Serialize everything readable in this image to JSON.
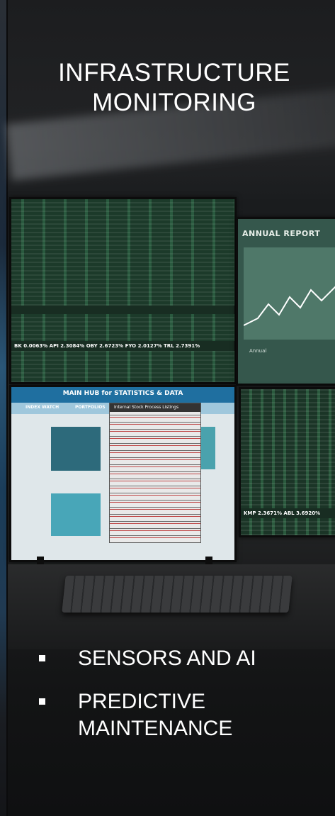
{
  "title": "INFRASTRUCTURE MONITORING",
  "title_lines": [
    "INFRASTRUCTURE",
    "MONITORING"
  ],
  "bullets": [
    {
      "lines": [
        "SENSORS AND AI"
      ]
    },
    {
      "lines": [
        "PREDICTIVE",
        "MAINTENANCE"
      ]
    }
  ],
  "screens": {
    "annual_report_title": "ANNUAL REPORT",
    "annual_label": "Annual",
    "hub_title": "MAIN HUB for STATISTICS & DATA",
    "hub_tab_left": "INDEX WATCH",
    "hub_tab_mid": "PORTFOLIOS",
    "listing_header": "Internal Stock Process Listings",
    "ticker_top": "BK 0.0063%   API 2.3084%   OBY 2.6723%   FYO 2.0127%   TRL 2.7391%",
    "ticker_bottom": "KMP 2.3671%   ABL 3.6920%"
  },
  "colors": {
    "text": "#ffffff",
    "background": "#16181b",
    "hub_blue": "#1f6fa0",
    "trading_green": "#1e3b2c"
  }
}
